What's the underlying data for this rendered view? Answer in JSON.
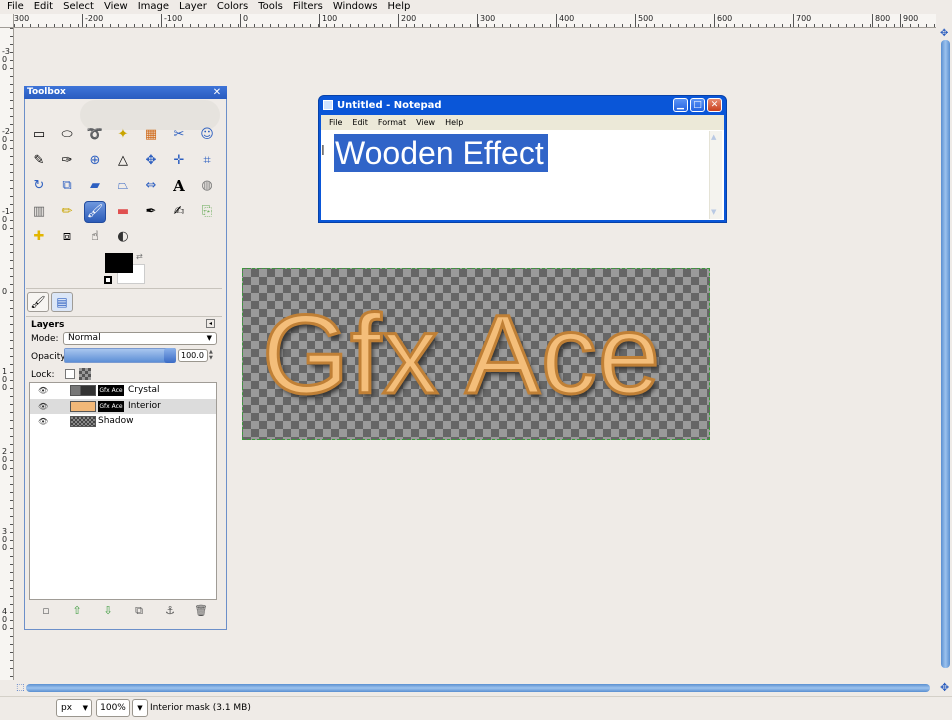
{
  "menu": [
    "File",
    "Edit",
    "Select",
    "View",
    "Image",
    "Layer",
    "Colors",
    "Tools",
    "Filters",
    "Windows",
    "Help"
  ],
  "ruler": {
    "h_labels": [
      "-300",
      "-200",
      "-100",
      "0",
      "100",
      "200",
      "300",
      "400",
      "500",
      "600",
      "700",
      "800",
      "900"
    ],
    "v_labels": [
      "-300",
      "-200",
      "-100",
      "0",
      "100",
      "200",
      "300",
      "400"
    ]
  },
  "toolbox": {
    "title": "Toolbox",
    "close": "✕",
    "tool_icons": [
      "rect-select-icon",
      "ellipse-select-icon",
      "lasso-icon",
      "fuzzy-select-icon",
      "select-by-color-icon",
      "scissors-icon",
      "foreground-select-icon",
      "paths-icon",
      "color-picker-icon",
      "zoom-icon",
      "measure-icon",
      "move-icon",
      "align-icon",
      "crop-icon",
      "rotate-icon",
      "scale-icon",
      "shear-icon",
      "perspective-icon",
      "flip-icon",
      "text-icon",
      "bucket-fill-icon",
      "blend-icon",
      "pencil-icon",
      "paintbrush-icon",
      "eraser-icon",
      "airbrush-icon",
      "ink-icon",
      "clone-icon",
      "heal-icon",
      "perspective-clone-icon",
      "smudge-icon",
      "dodge-burn-icon"
    ],
    "active_tool": "paintbrush-icon"
  },
  "colors": {
    "foreground": "#000000",
    "background": "#ffffff"
  },
  "layers": {
    "title": "Layers",
    "mode_label": "Mode:",
    "mode_value": "Normal",
    "opacity_label": "Opacity:",
    "opacity_value": "100.0",
    "opacity_fraction": 1.0,
    "lock_label": "Lock:",
    "items": [
      {
        "name": "Crystal",
        "mask_text": "Gfx Ace",
        "selected": false
      },
      {
        "name": "Interior",
        "mask_text": "Gfx Ace",
        "selected": true
      },
      {
        "name": "Shadow",
        "mask_text": "",
        "selected": false
      }
    ],
    "buttons": [
      "new-layer-icon",
      "raise-layer-icon",
      "lower-layer-icon",
      "duplicate-layer-icon",
      "anchor-layer-icon",
      "delete-layer-icon"
    ]
  },
  "notepad": {
    "title": "Untitled - Notepad",
    "menu": [
      "File",
      "Edit",
      "Format",
      "View",
      "Help"
    ],
    "text": "Wooden Effect"
  },
  "image": {
    "text": "Gfx Ace"
  },
  "status": {
    "unit": "px",
    "zoom": "100%",
    "message": "Interior mask (3.1 MB)"
  }
}
